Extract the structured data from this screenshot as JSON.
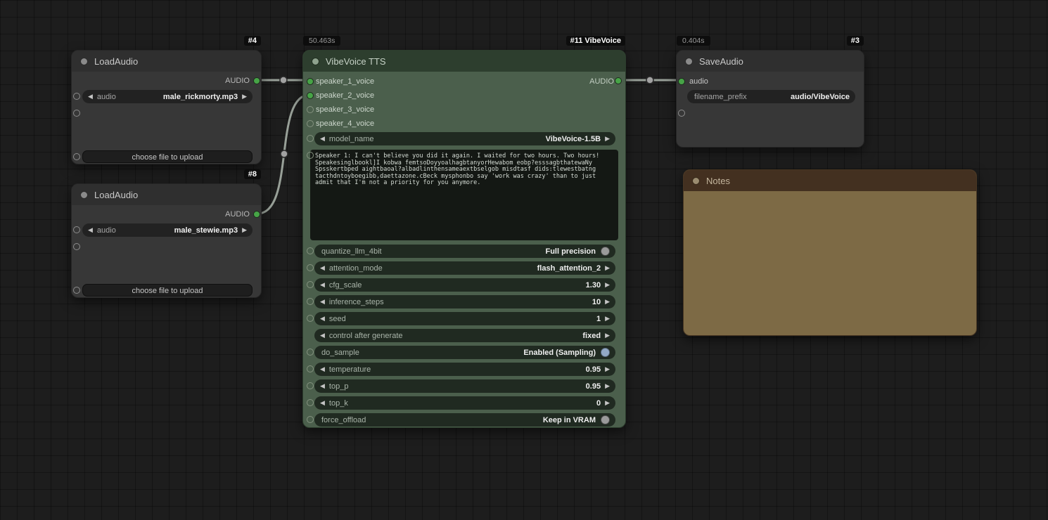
{
  "icons": {
    "arrow_left": "◀",
    "arrow_right": "▶"
  },
  "colors": {
    "connected_slot": "#47a447",
    "wire": "#98a098",
    "vibe_node_body": "#4b5f4c",
    "notes_node_body": "#7d6a45",
    "do_sample_knob": "#93a9c6"
  },
  "nodes": {
    "load_audio_1": {
      "id_badge": "#4",
      "title": "LoadAudio",
      "output_label": "AUDIO",
      "widget": {
        "label": "audio",
        "value": "male_rickmorty.mp3"
      },
      "upload_label": "choose file to upload"
    },
    "load_audio_2": {
      "id_badge": "#8",
      "title": "LoadAudio",
      "output_label": "AUDIO",
      "widget": {
        "label": "audio",
        "value": "male_stewie.mp3"
      },
      "upload_label": "choose file to upload"
    },
    "vibevoice": {
      "time_badge": "50.463s",
      "id_badge": "#11 VibeVoice",
      "title": "VibeVoice TTS",
      "inputs": [
        "speaker_1_voice",
        "speaker_2_voice",
        "speaker_3_voice",
        "speaker_4_voice"
      ],
      "output_label": "AUDIO",
      "model_name": {
        "label": "model_name",
        "value": "VibeVoice-1.5B"
      },
      "script_text": "Speaker 1: I can't believe you did it again. I waited for two hours. Two hours!\nSpeakesinglbookl]I kobwa femtsoDoyyoalhagbtanyorHewabom eobp?esssagbthatewaNy\nSpsskertbped aightbaoal?albadlinthensameaextbselgob misdtasf dids:tlewestbatng\ntacthdntoyboegibb,daettazone.cBeck mysphonbo say 'work was crazy' than to just\nadmit that I'm not a priority for you anymore.",
      "widgets": [
        {
          "type": "toggle",
          "label": "quantize_llm_4bit",
          "value": "Full precision"
        },
        {
          "type": "combo",
          "label": "attention_mode",
          "value": "flash_attention_2"
        },
        {
          "type": "number",
          "label": "cfg_scale",
          "value": "1.30"
        },
        {
          "type": "number",
          "label": "inference_steps",
          "value": "10"
        },
        {
          "type": "number",
          "label": "seed",
          "value": "1"
        },
        {
          "type": "combo",
          "label": "control after generate",
          "value": "fixed"
        },
        {
          "type": "toggle",
          "label": "do_sample",
          "value": "Enabled (Sampling)"
        },
        {
          "type": "number",
          "label": "temperature",
          "value": "0.95"
        },
        {
          "type": "number",
          "label": "top_p",
          "value": "0.95"
        },
        {
          "type": "number",
          "label": "top_k",
          "value": "0"
        },
        {
          "type": "toggle",
          "label": "force_offload",
          "value": "Keep in VRAM"
        }
      ]
    },
    "save_audio": {
      "time_badge": "0.404s",
      "id_badge": "#3",
      "title": "SaveAudio",
      "input_label": "audio",
      "widget": {
        "label": "filename_prefix",
        "value": "audio/VibeVoice"
      }
    },
    "notes": {
      "title": "Notes"
    }
  }
}
